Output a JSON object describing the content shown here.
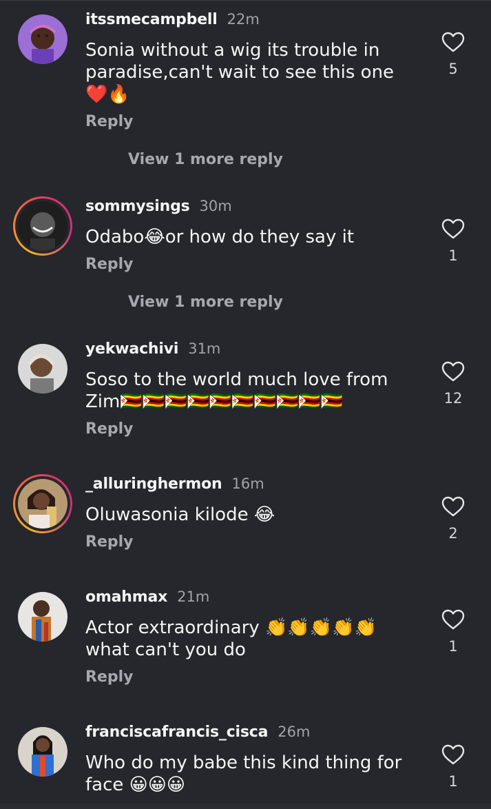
{
  "comments": [
    {
      "username": "itssmecampbell",
      "time": "22m",
      "text": "Sonia without a wig its trouble in paradise,can't wait to see this one ❤️🔥",
      "reply": "Reply",
      "view_more": "View 1 more reply",
      "likes": "5",
      "story_ring": false,
      "avatar_color": "#7b4ac0"
    },
    {
      "username": "sommysings",
      "time": "30m",
      "text": "Odabo😂or how do they say it",
      "reply": "Reply",
      "view_more": "View 1 more reply",
      "likes": "1",
      "story_ring": true,
      "avatar_color": "#2a2a2a"
    },
    {
      "username": "yekwachivi",
      "time": "31m",
      "text": "Soso to the world much love from Zim🇿🇼🇿🇼🇿🇼🇿🇼🇿🇼🇿🇼🇿🇼🇿🇼🇿🇼🇿🇼",
      "reply": "Reply",
      "view_more": "",
      "likes": "12",
      "story_ring": false,
      "avatar_color": "#cfcfcf"
    },
    {
      "username": "_alluringhermon",
      "time": "16m",
      "text": "Oluwasonia kilode 😂",
      "reply": "Reply",
      "view_more": "",
      "likes": "2",
      "story_ring": true,
      "avatar_color": "#8c6a4a"
    },
    {
      "username": "omahmax",
      "time": "21m",
      "text": "Actor extraordinary 👏👏👏👏👏 what can't you do",
      "reply": "Reply",
      "view_more": "",
      "likes": "1",
      "story_ring": false,
      "avatar_color": "#c98a3a"
    },
    {
      "username": "franciscafrancis_cisca",
      "time": "26m",
      "text": "Who do my babe this kind thing for face 😀😀😀",
      "reply": "",
      "view_more": "",
      "likes": "1",
      "story_ring": false,
      "avatar_color": "#3a7bd5"
    }
  ],
  "colors": {
    "background": "#25272c",
    "secondary_text": "#a5a8ae",
    "primary_text": "#f5f5f7"
  },
  "icons": {
    "like": "heart-outline-icon"
  }
}
